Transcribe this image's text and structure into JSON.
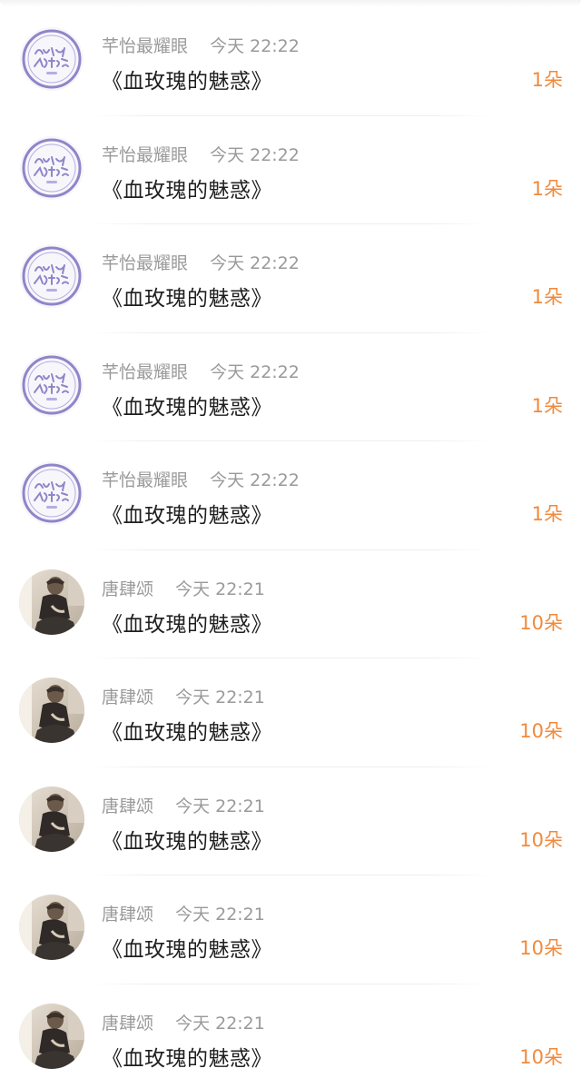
{
  "items": [
    {
      "sender": "芊怡最耀眼",
      "time": "今天 22:22",
      "gift": "《血玫瑰的魅惑》",
      "count": "1朵",
      "avatar": "stamp-avatar"
    },
    {
      "sender": "芊怡最耀眼",
      "time": "今天 22:22",
      "gift": "《血玫瑰的魅惑》",
      "count": "1朵",
      "avatar": "stamp-avatar"
    },
    {
      "sender": "芊怡最耀眼",
      "time": "今天 22:22",
      "gift": "《血玫瑰的魅惑》",
      "count": "1朵",
      "avatar": "stamp-avatar"
    },
    {
      "sender": "芊怡最耀眼",
      "time": "今天 22:22",
      "gift": "《血玫瑰的魅惑》",
      "count": "1朵",
      "avatar": "stamp-avatar"
    },
    {
      "sender": "芊怡最耀眼",
      "time": "今天 22:22",
      "gift": "《血玫瑰的魅惑》",
      "count": "1朵",
      "avatar": "stamp-avatar"
    },
    {
      "sender": "唐肆颂",
      "time": "今天 22:21",
      "gift": "《血玫瑰的魅惑》",
      "count": "10朵",
      "avatar": "photo-avatar"
    },
    {
      "sender": "唐肆颂",
      "time": "今天 22:21",
      "gift": "《血玫瑰的魅惑》",
      "count": "10朵",
      "avatar": "photo-avatar"
    },
    {
      "sender": "唐肆颂",
      "time": "今天 22:21",
      "gift": "《血玫瑰的魅惑》",
      "count": "10朵",
      "avatar": "photo-avatar"
    },
    {
      "sender": "唐肆颂",
      "time": "今天 22:21",
      "gift": "《血玫瑰的魅惑》",
      "count": "10朵",
      "avatar": "photo-avatar"
    },
    {
      "sender": "唐肆颂",
      "time": "今天 22:21",
      "gift": "《血玫瑰的魅惑》",
      "count": "10朵",
      "avatar": "photo-avatar"
    }
  ],
  "colors": {
    "count": "#f08a3c",
    "meta": "#9a9a9a",
    "stamp": "#8f86c8"
  }
}
